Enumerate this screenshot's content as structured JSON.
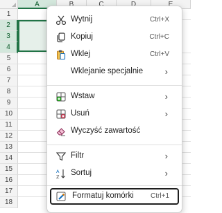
{
  "sheet": {
    "columns": [
      "A",
      "B",
      "C",
      "D",
      "E"
    ],
    "rows": [
      "1",
      "2",
      "3",
      "4",
      "5",
      "6",
      "7",
      "8",
      "9",
      "10",
      "11",
      "12",
      "13",
      "14",
      "15",
      "16",
      "17",
      "18"
    ],
    "selected_column": "A",
    "selected_rows": [
      "2",
      "3",
      "4"
    ]
  },
  "context_menu": {
    "items": [
      {
        "label": "Wytnij",
        "shortcut": "Ctrl+X",
        "icon": "scissors-icon"
      },
      {
        "label": "Kopiuj",
        "shortcut": "Ctrl+C",
        "icon": "copy-icon"
      },
      {
        "label": "Wklej",
        "shortcut": "Ctrl+V",
        "icon": "paste-icon"
      },
      {
        "label": "Wklejanie specjalnie",
        "icon": "chevron-right-icon"
      },
      {
        "label": "Wstaw",
        "icon": "insert-cells-icon"
      },
      {
        "label": "Usuń",
        "icon": "delete-cells-icon"
      },
      {
        "label": "Wyczyść zawartość",
        "icon": "eraser-icon"
      },
      {
        "label": "Filtr",
        "icon": "filter-icon"
      },
      {
        "label": "Sortuj",
        "icon": "sort-icon"
      },
      {
        "label": "Formatuj komórki",
        "shortcut": "Ctrl+1",
        "icon": "format-cells-icon"
      }
    ]
  },
  "colors": {
    "accent_green": "#217346",
    "selection_fill": "#e6f0ea",
    "icon_blue": "#0f6cbd",
    "icon_red": "#c4314b",
    "icon_orange": "#d47500"
  }
}
